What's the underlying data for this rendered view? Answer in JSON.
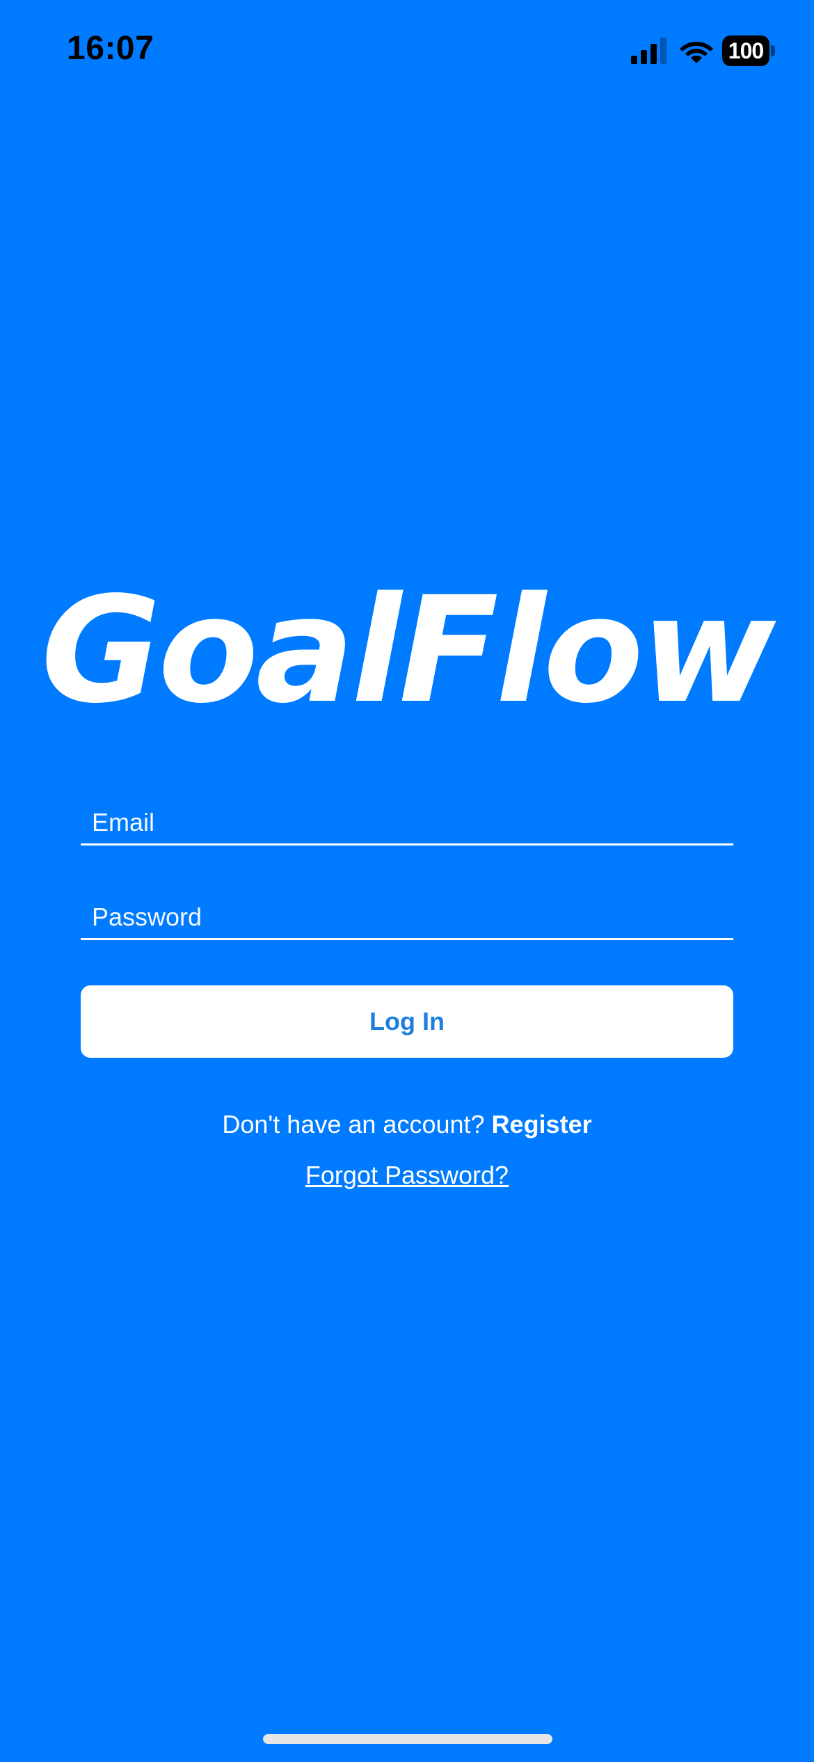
{
  "status_bar": {
    "time": "16:07",
    "battery_level": "100",
    "signal_icon": "cellular-signal-icon",
    "wifi_icon": "wifi-icon"
  },
  "app": {
    "logo_text": "GoalFlow"
  },
  "login_form": {
    "email_placeholder": "Email",
    "password_placeholder": "Password",
    "login_label": "Log In"
  },
  "links": {
    "register_prompt": "Don't have an account?",
    "register_label": "Register",
    "forgot_password_label": "Forgot Password?"
  },
  "colors": {
    "background": "#007bff",
    "button_text": "#1f7fe0",
    "button_bg": "#ffffff"
  }
}
